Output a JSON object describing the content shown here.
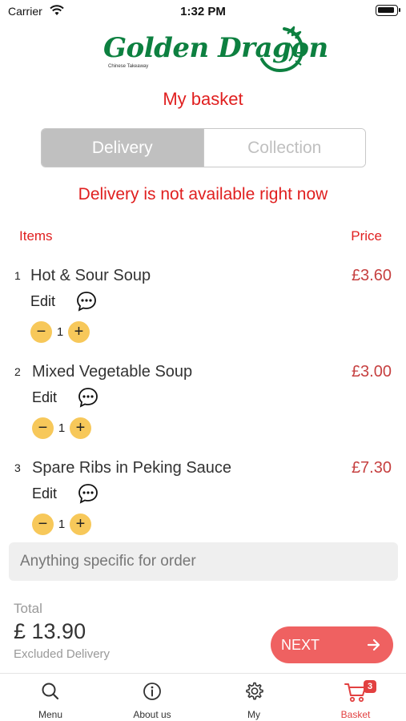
{
  "status_bar": {
    "carrier": "Carrier",
    "time": "1:32 PM"
  },
  "logo": {
    "name": "Golden Dragon",
    "subtitle": "Chinese Takeaway"
  },
  "title": "My basket",
  "segment": {
    "delivery_label": "Delivery",
    "collection_label": "Collection",
    "selected": "Delivery"
  },
  "notice": "Delivery is not available right now",
  "columns": {
    "items": "Items",
    "price": "Price"
  },
  "items": [
    {
      "num": "1",
      "name": "Hot & Sour Soup",
      "price": "£3.60",
      "edit": "Edit",
      "qty": "1"
    },
    {
      "num": "2",
      "name": "Mixed Vegetable Soup",
      "price": "£3.00",
      "edit": "Edit",
      "qty": "1"
    },
    {
      "num": "3",
      "name": "Spare Ribs in Peking Sauce",
      "price": "£7.30",
      "edit": "Edit",
      "qty": "1"
    }
  ],
  "note": {
    "placeholder": "Anything specific for order",
    "value": ""
  },
  "total": {
    "label": "Total",
    "value": "£ 13.90",
    "sub": "Excluded Delivery"
  },
  "next": {
    "label": "NEXT",
    "icon": "arrow-right-icon"
  },
  "tabs": [
    {
      "label": "Menu",
      "icon": "search-icon"
    },
    {
      "label": "About us",
      "icon": "info-icon"
    },
    {
      "label": "My",
      "icon": "gear-icon"
    },
    {
      "label": "Basket",
      "icon": "cart-icon",
      "badge": "3",
      "active": true
    }
  ],
  "colors": {
    "accent_red": "#e01f1f",
    "price_red": "#c64040",
    "brand_green": "#0d8040",
    "qty_yellow": "#f7c85a",
    "next_button": "#ef6161"
  }
}
